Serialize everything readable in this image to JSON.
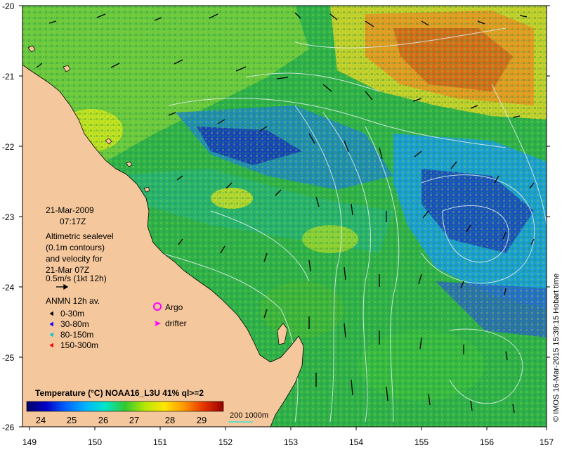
{
  "map": {
    "lon_range": [
      149,
      157
    ],
    "lat_range": [
      -26,
      -20
    ],
    "x_ticks": [
      "149",
      "150",
      "151",
      "152",
      "153",
      "154",
      "155",
      "156",
      "157"
    ],
    "y_ticks": [
      "-20",
      "-21",
      "-22",
      "-23",
      "-24",
      "-25",
      "-26"
    ],
    "land_color": "#f5c79c",
    "contour_color": "#d9e8ea"
  },
  "info": {
    "date": "21-Mar-2009",
    "time": "07:17Z",
    "sealevel_lines": [
      "Altimetric sealevel",
      "(0.1m contours)",
      "and velocity for",
      "21-Mar 07Z"
    ],
    "scale_label": "0.5m/s (1kt 12h)"
  },
  "moorings": {
    "title": "ANMN 12h av.",
    "items": [
      {
        "label": "0-30m",
        "color": "#000000"
      },
      {
        "label": "30-80m",
        "color": "#0000ff"
      },
      {
        "label": "80-150m",
        "color": "#00c8d2"
      },
      {
        "label": "150-300m",
        "color": "#ff0000"
      }
    ]
  },
  "markers": {
    "argo": "Argo",
    "argo_color": "#ff00ff",
    "drifter": "drifter",
    "drifter_color": "#ff00ff"
  },
  "colorbar": {
    "title": "Temperature (°C) NOAA16_L3U 41% ql>=2",
    "ticks": [
      "24",
      "25",
      "26",
      "27",
      "28",
      "29"
    ],
    "range": [
      23.5,
      29.8
    ],
    "stops": [
      "#000064",
      "#0000c8",
      "#0064ff",
      "#00b4ff",
      "#00e6c8",
      "#32c832",
      "#b4e600",
      "#ffe600",
      "#ff9600",
      "#e63200",
      "#960000"
    ]
  },
  "depth_legend": {
    "label": "200  1000m",
    "color": "#40e0d0"
  },
  "credit": "© IMOS 16-Mar-2015 15:39:15 Hobart time"
}
